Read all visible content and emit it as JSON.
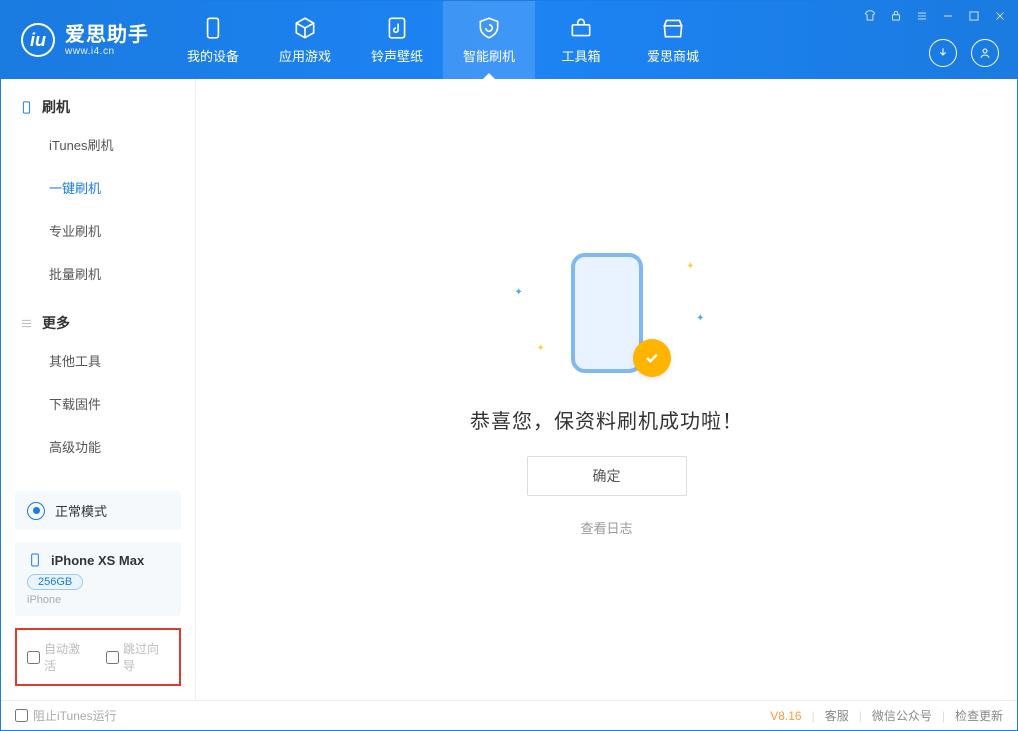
{
  "brand": {
    "title": "爱思助手",
    "subtitle": "www.i4.cn"
  },
  "nav": {
    "items": [
      {
        "label": "我的设备"
      },
      {
        "label": "应用游戏"
      },
      {
        "label": "铃声壁纸"
      },
      {
        "label": "智能刷机"
      },
      {
        "label": "工具箱"
      },
      {
        "label": "爱思商城"
      }
    ]
  },
  "sidebar": {
    "section_flash": {
      "title": "刷机",
      "items": [
        "iTunes刷机",
        "一键刷机",
        "专业刷机",
        "批量刷机"
      ]
    },
    "section_more": {
      "title": "更多",
      "items": [
        "其他工具",
        "下载固件",
        "高级功能"
      ]
    }
  },
  "mode_box": {
    "label": "正常模式"
  },
  "device_box": {
    "name": "iPhone XS Max",
    "capacity": "256GB",
    "type": "iPhone"
  },
  "options": {
    "auto_activate": "自动激活",
    "skip_guide": "跳过向导"
  },
  "main": {
    "headline": "恭喜您，保资料刷机成功啦！",
    "ok_button": "确定",
    "view_log": "查看日志"
  },
  "footer": {
    "block_itunes": "阻止iTunes运行",
    "version": "V8.16",
    "links": [
      "客服",
      "微信公众号",
      "检查更新"
    ]
  }
}
